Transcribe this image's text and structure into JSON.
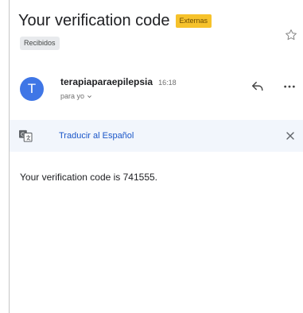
{
  "email": {
    "subject": "Your verification code",
    "external_badge": "Externas",
    "label": "Recibidos",
    "sender": {
      "avatar_letter": "T",
      "name": "terapiaparaepilepsia",
      "time": "16:18",
      "recipient": "para yo"
    },
    "translate_bar": {
      "link": "Traducir al Español"
    },
    "body": "Your verification code is 741555."
  },
  "colors": {
    "badge": "#f6c22b",
    "avatar": "#3f76e6",
    "translate_bar_bg": "#f2f6fc",
    "link": "#1a56c8"
  },
  "icons": {
    "star": "star-outline-icon",
    "reply": "reply-icon",
    "more": "more-horizontal-icon",
    "translate": "translate-icon",
    "close": "close-icon",
    "chevron": "chevron-down-icon"
  }
}
